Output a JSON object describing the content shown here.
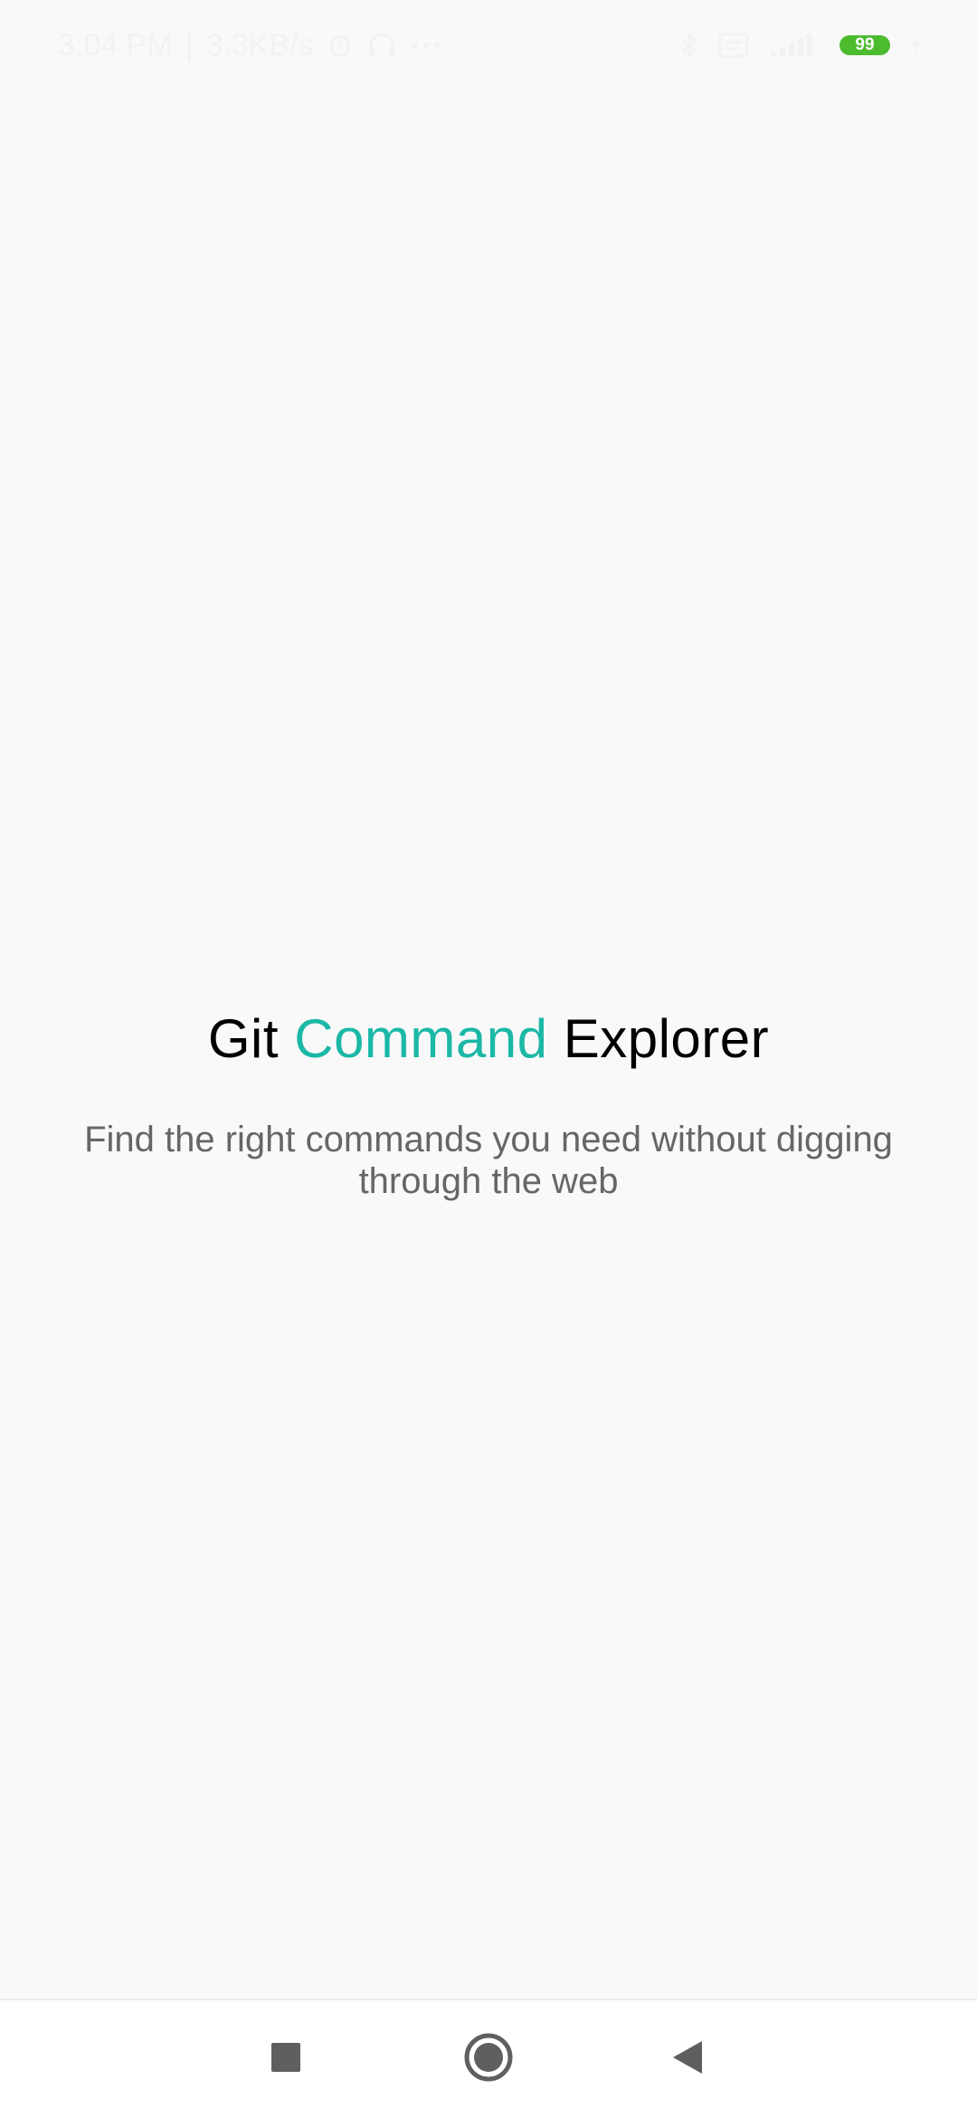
{
  "status_bar": {
    "time": "3:04 PM",
    "separator": "|",
    "net_speed": "3.3KB/s",
    "battery_level": "99",
    "icons": [
      "alarm-icon",
      "headset-icon",
      "more-dots-icon",
      "bluetooth-icon",
      "sim-card-icon",
      "signal-icon",
      "battery-icon",
      "charging-icon"
    ]
  },
  "main": {
    "title_part1": "Git",
    "title_accent": "Command",
    "title_part3": "Explorer",
    "subtitle": "Find the right commands you need without digging through the web"
  },
  "nav_bar": {
    "buttons": [
      "recents-icon",
      "home-icon",
      "back-icon"
    ]
  },
  "colors": {
    "background": "#f9f9f9",
    "accent": "#1bb8a6",
    "title": "#000000",
    "subtitle": "#666666",
    "battery": "#4cbb2e",
    "nav_icon": "#5f5f5f"
  }
}
